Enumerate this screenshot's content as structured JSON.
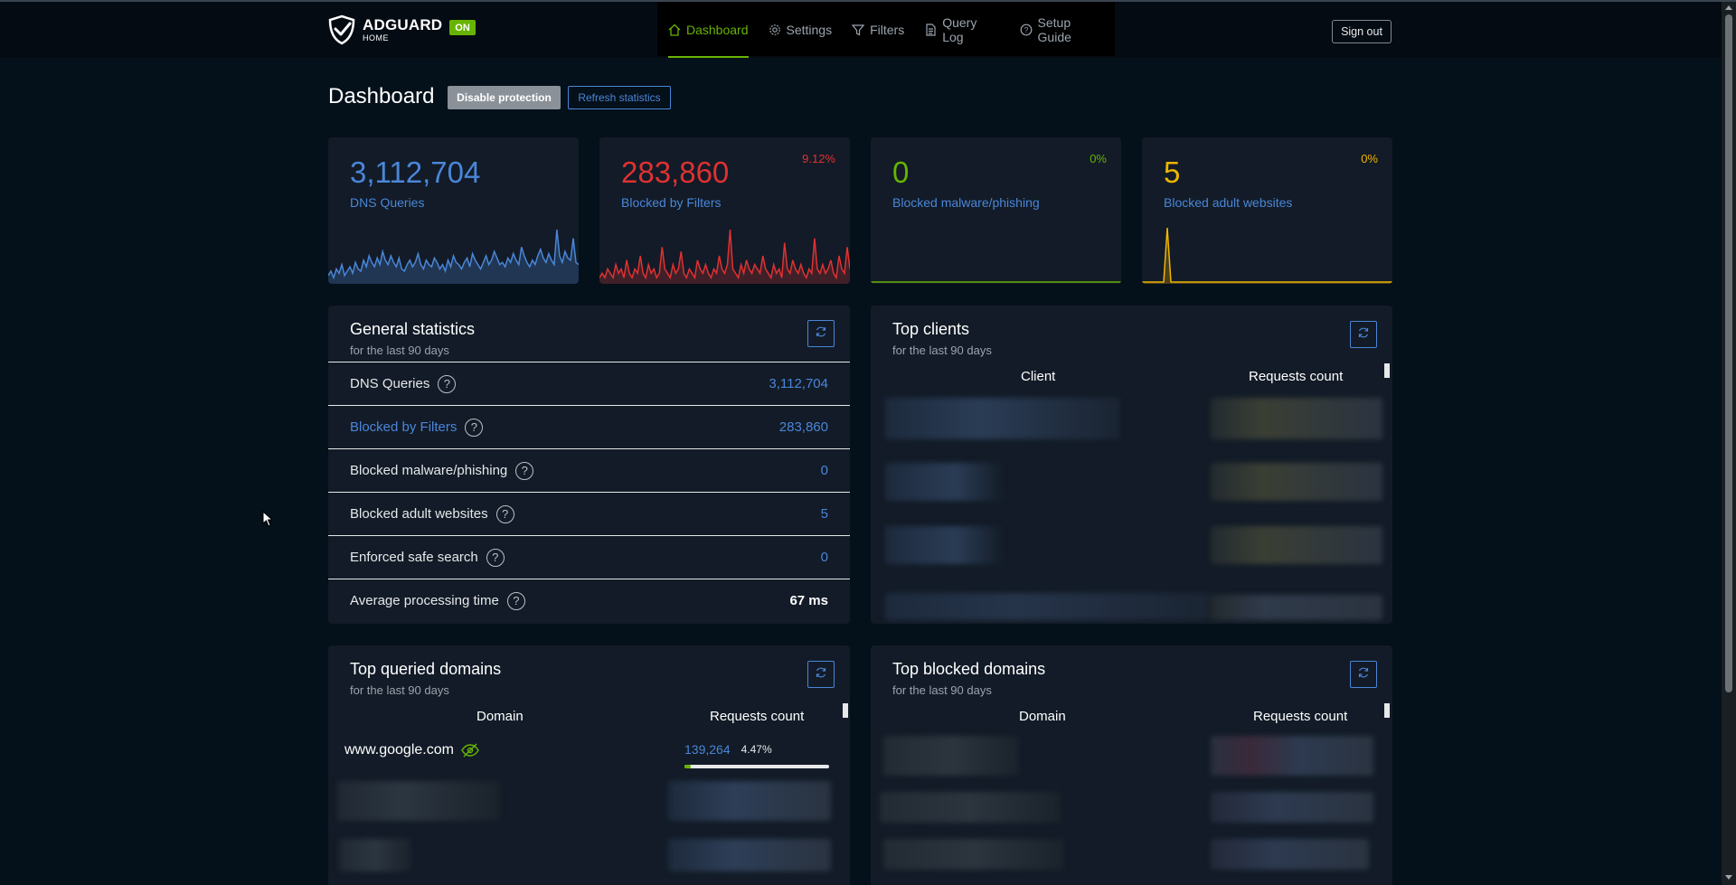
{
  "header": {
    "logo_main": "ADGUARD",
    "logo_sub": "HOME",
    "status_badge": "ON",
    "nav": [
      {
        "label": "Dashboard",
        "icon": "home-icon",
        "active": true
      },
      {
        "label": "Settings",
        "icon": "gear-icon",
        "active": false
      },
      {
        "label": "Filters",
        "icon": "filter-icon",
        "active": false
      },
      {
        "label": "Query Log",
        "icon": "document-icon",
        "active": false
      },
      {
        "label": "Setup Guide",
        "icon": "help-circle-icon",
        "active": false
      }
    ],
    "sign_out": "Sign out"
  },
  "page": {
    "title": "Dashboard",
    "disable_protection": "Disable protection",
    "refresh_statistics": "Refresh statistics"
  },
  "stats": [
    {
      "value": "3,112,704",
      "label": "DNS Queries",
      "percent": "",
      "color": "#4a86d8"
    },
    {
      "value": "283,860",
      "label": "Blocked by Filters",
      "percent": "9.12%",
      "color": "#e03131"
    },
    {
      "value": "0",
      "label": "Blocked malware/phishing",
      "percent": "0%",
      "color": "#67b302"
    },
    {
      "value": "5",
      "label": "Blocked adult websites",
      "percent": "0%",
      "color": "#f0b400"
    }
  ],
  "general_statistics": {
    "title": "General statistics",
    "subtitle": "for the last 90 days",
    "rows": [
      {
        "label": "DNS Queries",
        "value": "3,112,704"
      },
      {
        "label": "Blocked by Filters",
        "value": "283,860"
      },
      {
        "label": "Blocked malware/phishing",
        "value": "0"
      },
      {
        "label": "Blocked adult websites",
        "value": "5"
      },
      {
        "label": "Enforced safe search",
        "value": "0"
      },
      {
        "label": "Average processing time",
        "value": "67 ms"
      }
    ]
  },
  "top_clients": {
    "title": "Top clients",
    "subtitle": "for the last 90 days",
    "col_client": "Client",
    "col_requests": "Requests count"
  },
  "top_queried": {
    "title": "Top queried domains",
    "subtitle": "for the last 90 days",
    "col_domain": "Domain",
    "col_requests": "Requests count",
    "first_domain": "www.google.com",
    "first_count": "139,264",
    "first_percent": "4.47%",
    "first_fraction": 0.0447
  },
  "top_blocked": {
    "title": "Top blocked domains",
    "subtitle": "for the last 90 days",
    "col_domain": "Domain",
    "col_requests": "Requests count"
  },
  "colors": {
    "accent_green": "#67b302",
    "accent_blue": "#4a86d8",
    "accent_red": "#e03131",
    "accent_yellow": "#f0b400",
    "background": "#04101a",
    "card": "#121b27"
  },
  "sparklines": {
    "dns": [
      3,
      5,
      2,
      6,
      4,
      8,
      3,
      5,
      7,
      4,
      9,
      6,
      5,
      10,
      7,
      12,
      9,
      7,
      11,
      8,
      14,
      10,
      8,
      12,
      9,
      7,
      11,
      6,
      5,
      8,
      10,
      7,
      9,
      13,
      8,
      6,
      10,
      8,
      7,
      11,
      9,
      6,
      8,
      5,
      10,
      7,
      12,
      9,
      8,
      6,
      9,
      11,
      7,
      13,
      10,
      8,
      6,
      9,
      12,
      8,
      10,
      14,
      11,
      8,
      9,
      7,
      11,
      9,
      13,
      10,
      8,
      16,
      12,
      9,
      7,
      10,
      8,
      12,
      15,
      11,
      9,
      13,
      10,
      8,
      24,
      12,
      9,
      14,
      11,
      10,
      20,
      9,
      8
    ],
    "blocked": [
      1,
      2,
      1,
      3,
      2,
      1,
      4,
      2,
      3,
      1,
      5,
      2,
      1,
      3,
      2,
      6,
      2,
      1,
      4,
      2,
      3,
      1,
      2,
      8,
      3,
      2,
      1,
      4,
      2,
      3,
      7,
      2,
      1,
      3,
      2,
      1,
      5,
      3,
      2,
      4,
      2,
      1,
      3,
      2,
      6,
      3,
      2,
      4,
      12,
      3,
      2,
      1,
      4,
      2,
      5,
      3,
      2,
      4,
      3,
      2,
      6,
      3,
      2,
      1,
      4,
      2,
      3,
      1,
      9,
      3,
      2,
      5,
      3,
      2,
      4,
      2,
      1,
      3,
      2,
      10,
      3,
      2,
      4,
      2,
      3,
      5,
      2,
      1,
      6,
      3,
      2,
      8,
      3
    ]
  }
}
